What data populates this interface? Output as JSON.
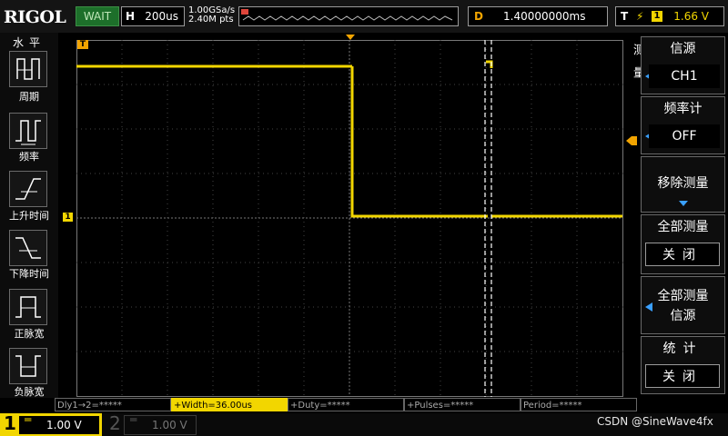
{
  "brand": "RIGOL",
  "status": "WAIT",
  "timebase": {
    "label": "H",
    "value": "200us"
  },
  "sample": {
    "rate": "1.00GSa/s",
    "points": "2.40M pts"
  },
  "delay": {
    "label": "D",
    "value": "1.40000000ms"
  },
  "trigger": {
    "label": "T",
    "edge_symbol": "⚡",
    "channel": "1",
    "level": "1.66 V"
  },
  "left_panel": {
    "title": "水平",
    "items": [
      {
        "label": "周期"
      },
      {
        "label": "频率"
      },
      {
        "label": "上升时间"
      },
      {
        "label": "下降时间"
      },
      {
        "label": "正脉宽"
      },
      {
        "label": "负脉宽"
      }
    ]
  },
  "right_panel": {
    "side_tab": "测量",
    "source": {
      "title": "信源",
      "value": "CH1"
    },
    "counter": {
      "title": "频率计",
      "value": "OFF"
    },
    "remove": {
      "title": "移除测量"
    },
    "all_measure": {
      "title": "全部测量",
      "value": "关闭"
    },
    "all_source": {
      "title_line1": "全部测量",
      "title_line2": "信源"
    },
    "stats": {
      "title": "统计",
      "value": "关闭"
    }
  },
  "measurements": [
    {
      "label": "Dly1→2=*****",
      "active": false
    },
    {
      "label": "+Width=36.00us",
      "active": true
    },
    {
      "label": "+Duty=*****",
      "active": false
    },
    {
      "label": "+Pulses=*****",
      "active": false
    },
    {
      "label": "Period=*****",
      "active": false
    }
  ],
  "channels": {
    "ch1": {
      "number": "1",
      "symbol": "═",
      "scale": "1.00 V"
    },
    "ch2": {
      "number": "2",
      "symbol": "═",
      "scale": "1.00 V"
    }
  },
  "markers": {
    "trigger_marker": "T",
    "channel_marker": "1"
  },
  "watermark": "CSDN @SineWave4fx",
  "colors": {
    "ch1": "#f2d600",
    "accent": "#f2a400",
    "status_bg": "#1d6f2a",
    "right_arrow": "#3aa0ff"
  }
}
